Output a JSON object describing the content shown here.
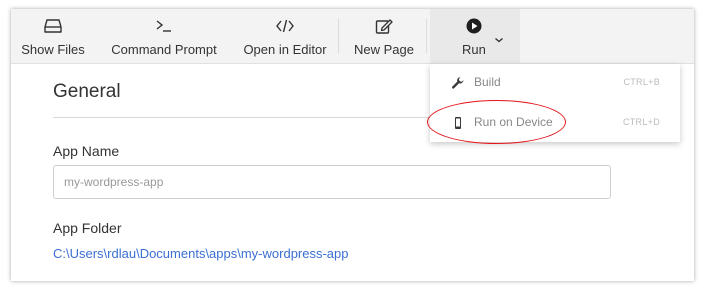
{
  "toolbar": {
    "show_files": {
      "label": "Show Files",
      "icon": "drive-icon"
    },
    "command_prompt": {
      "label": "Command Prompt",
      "icon": "terminal-icon"
    },
    "open_in_editor": {
      "label": "Open in Editor",
      "icon": "code-icon"
    },
    "new_page": {
      "label": "New Page",
      "icon": "edit-page-icon"
    },
    "run": {
      "label": "Run",
      "icon": "play-icon"
    }
  },
  "general": {
    "title": "General",
    "app_name_label": "App Name",
    "app_name_placeholder": "my-wordpress-app",
    "app_folder_label": "App Folder",
    "app_folder_path": "C:\\Users\\rdlau\\Documents\\apps\\my-wordpress-app"
  },
  "run_menu": {
    "items": [
      {
        "label": "Build",
        "shortcut": "CTRL+B",
        "icon": "wrench-icon"
      },
      {
        "label": "Run on Device",
        "shortcut": "CTRL+D",
        "icon": "mobile-device-icon"
      }
    ]
  },
  "colors": {
    "toolbar_bg": "#f3f3f3",
    "link": "#3b6fd4",
    "highlight": "#e3151a"
  }
}
